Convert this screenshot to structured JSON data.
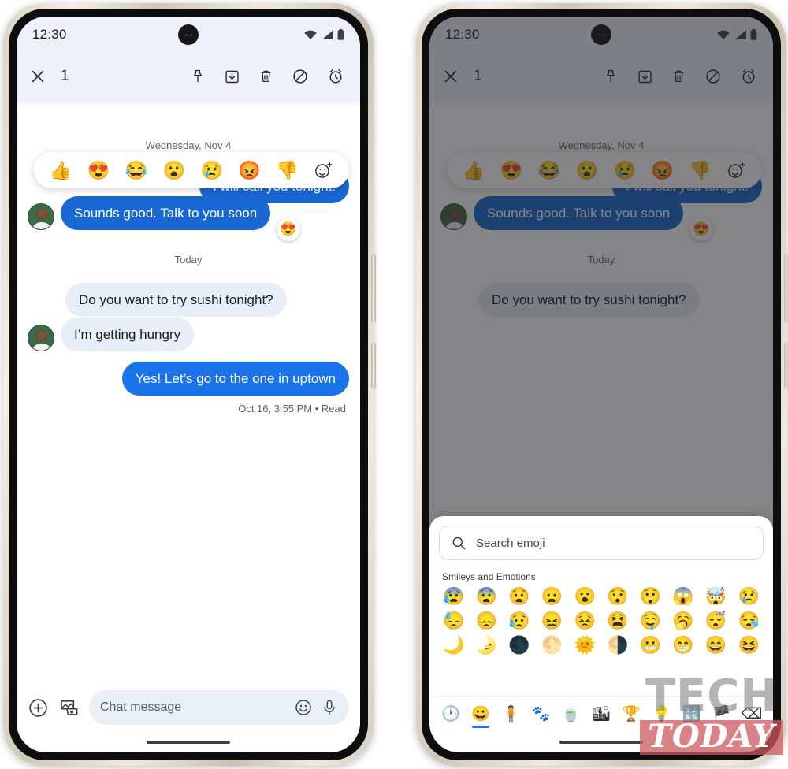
{
  "statusbar": {
    "time": "12:30",
    "wifi_icon": "wifi-icon",
    "signal_icon": "cellular-signal-icon",
    "battery_icon": "battery-icon"
  },
  "actionbar": {
    "close_icon": "close-icon",
    "selected_count": "1",
    "actions": [
      {
        "name": "pin-icon",
        "label": "Pin"
      },
      {
        "name": "archive-icon",
        "label": "Archive"
      },
      {
        "name": "delete-icon",
        "label": "Delete"
      },
      {
        "name": "block-icon",
        "label": "Block"
      },
      {
        "name": "snooze-alarm-icon",
        "label": "Snooze"
      }
    ]
  },
  "conversation": {
    "day_separator_1": "Wednesday, Nov 4",
    "day_separator_2": "Today",
    "hidden_bubble_text": "I will call you tonight!",
    "messages": [
      {
        "text": "Sounds good. Talk to you soon",
        "dir": "in-blue",
        "reaction": "😍"
      },
      {
        "text": "Do you want to try sushi tonight?",
        "dir": "in"
      },
      {
        "text": "I’m getting hungry",
        "dir": "in"
      },
      {
        "text": "Yes! Let’s go to the one in uptown",
        "dir": "out"
      }
    ],
    "receipt": "Oct 16, 3:55 PM • Read"
  },
  "reaction_bar": {
    "emojis": [
      "👍",
      "😍",
      "😂",
      "😮",
      "😢",
      "😡",
      "👎"
    ],
    "more_icon": "add-reaction-icon"
  },
  "composer": {
    "plus_icon": "add-attachment-icon",
    "gallery_icon": "gallery-camera-icon",
    "placeholder": "Chat message",
    "emoji_icon": "emoji-icon",
    "mic_icon": "microphone-icon"
  },
  "emoji_picker": {
    "search_icon": "search-icon",
    "search_placeholder": "Search emoji",
    "section_title": "Smileys and Emotions",
    "rows": [
      [
        "😰",
        "😨",
        "😧",
        "😦",
        "😮",
        "😯",
        "😲",
        "😱",
        "🤯",
        "😢"
      ],
      [
        "😓",
        "😞",
        "😥",
        "😖",
        "😣",
        "😫",
        "🤤",
        "🥱",
        "😴",
        "😪"
      ],
      [
        "🌙",
        "🌛",
        "🌑",
        "🌕",
        "🌞",
        "🌗",
        "😬",
        "😁",
        "😄",
        "😆"
      ]
    ],
    "categories": [
      {
        "name": "category-recent",
        "icon": "🕐",
        "active": false
      },
      {
        "name": "category-smileys",
        "icon": "😀",
        "active": true
      },
      {
        "name": "category-people",
        "icon": "🧍",
        "active": false
      },
      {
        "name": "category-nature",
        "icon": "🐾",
        "active": false
      },
      {
        "name": "category-food",
        "icon": "🍵",
        "active": false
      },
      {
        "name": "category-travel",
        "icon": "🏙",
        "active": false
      },
      {
        "name": "category-activities",
        "icon": "🏆",
        "active": false
      },
      {
        "name": "category-objects",
        "icon": "💡",
        "active": false
      },
      {
        "name": "category-symbols",
        "icon": "🔣",
        "active": false
      },
      {
        "name": "category-flags",
        "icon": "🏴",
        "active": false
      },
      {
        "name": "category-backspace",
        "icon": "⌫",
        "active": false
      }
    ]
  },
  "watermark": {
    "line1": "TECH",
    "line2": "TODAY"
  },
  "colors": {
    "accent_blue": "#1a73e8",
    "bubble_out": "#1967d2",
    "bubble_in": "#e8eef7",
    "header_bg": "#eef1fa"
  }
}
